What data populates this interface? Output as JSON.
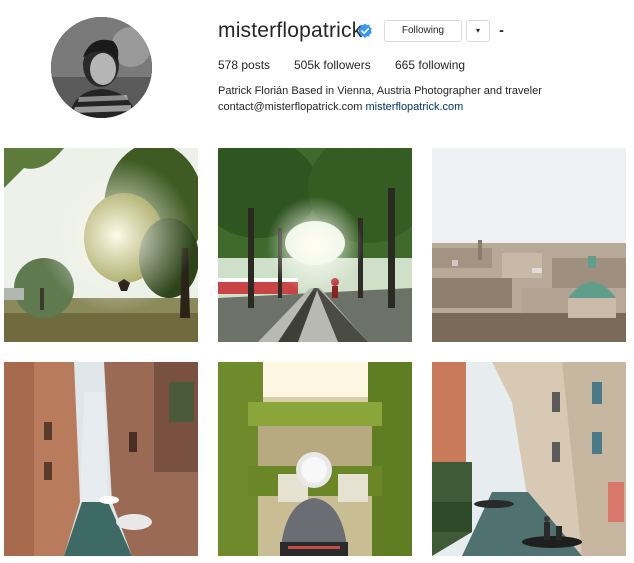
{
  "profile": {
    "username": "misterflopatrick",
    "verified": true,
    "verified_color": "#3897f0",
    "follow_button_label": "Following",
    "dropdown_icon": "▾",
    "more_icon": "•••",
    "stats": {
      "posts": "578 posts",
      "followers": "505k followers",
      "following": "665 following"
    },
    "bio_line1": "Patrick Florián Based in Vienna, Austria Photographer and traveler",
    "bio_email": "contact@misterflopatrick.com",
    "bio_website": "misterflopatrick.com",
    "link_color": "#003569"
  },
  "posts": [
    {
      "subject": "park-with-sunlight-and-jumping-person"
    },
    {
      "subject": "tree-lined-avenue-with-cyclist"
    },
    {
      "subject": "vienna-rooftop-cityscape"
    },
    {
      "subject": "venice-narrow-canal"
    },
    {
      "subject": "courtyard-ivy-holding-cup"
    },
    {
      "subject": "venice-canal-gondolas"
    }
  ]
}
